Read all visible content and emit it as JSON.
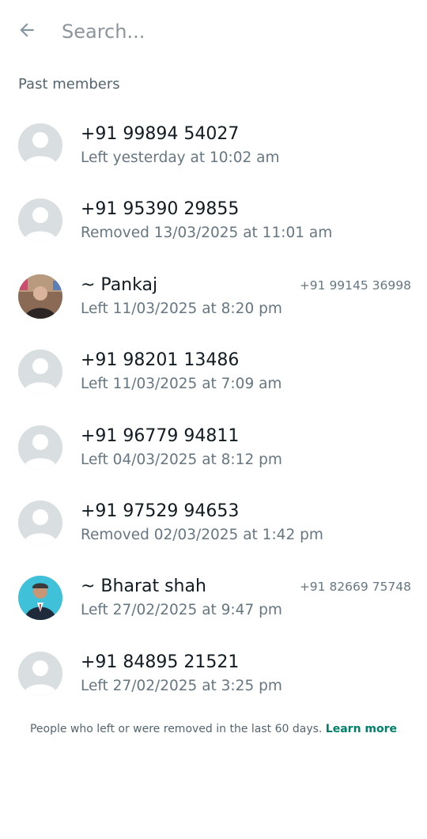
{
  "header": {
    "back_icon": "arrow-left-icon",
    "search_placeholder": "Search...",
    "search_value": ""
  },
  "section_title": "Past members",
  "members": [
    {
      "name": "+91 99894 54027",
      "status": "Left yesterday at 10:02 am",
      "phone": "",
      "avatar": "default-avatar-icon"
    },
    {
      "name": "+91 95390 29855",
      "status": "Removed 13/03/2025 at 11:01 am",
      "phone": "",
      "avatar": "default-avatar-icon"
    },
    {
      "name": "~ Pankaj",
      "status": "Left 11/03/2025 at 8:20 pm",
      "phone": "+91 99145 36998",
      "avatar": "photo-avatar"
    },
    {
      "name": "+91 98201 13486",
      "status": "Left 11/03/2025 at 7:09 am",
      "phone": "",
      "avatar": "default-avatar-icon"
    },
    {
      "name": "+91 96779 94811",
      "status": "Left 04/03/2025 at 8:12 pm",
      "phone": "",
      "avatar": "default-avatar-icon"
    },
    {
      "name": "+91 97529 94653",
      "status": "Removed 02/03/2025 at 1:42 pm",
      "phone": "",
      "avatar": "default-avatar-icon"
    },
    {
      "name": "~ Bharat shah",
      "status": "Left 27/02/2025 at 9:47 pm",
      "phone": "+91 82669 75748",
      "avatar": "photo-avatar"
    },
    {
      "name": "+91 84895 21521",
      "status": "Left 27/02/2025 at 3:25 pm",
      "phone": "",
      "avatar": "default-avatar-icon"
    }
  ],
  "footer": {
    "text": "People who left or were removed in the last 60 days.",
    "link": "Learn more"
  },
  "colors": {
    "accent": "#008069",
    "secondary_text": "#667781",
    "avatar_bg": "#d9dee1"
  }
}
